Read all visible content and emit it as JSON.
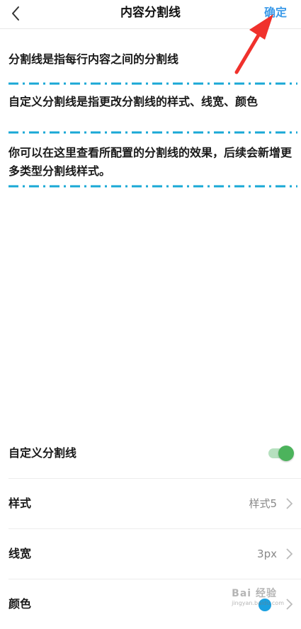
{
  "header": {
    "title": "内容分割线",
    "confirm_label": "确定"
  },
  "preview": {
    "paragraphs": [
      "分割线是指每行内容之间的分割线",
      "自定义分割线是指更改分割线的样式、线宽、颜色",
      "你可以在这里查看所配置的分割线的效果，后续会新增更多类型分割线样式。"
    ],
    "divider_color": "#1aa8d6"
  },
  "settings": {
    "custom_divider": {
      "label": "自定义分割线",
      "enabled": true,
      "toggle_color": "#4cb35c"
    },
    "style": {
      "label": "样式",
      "value": "样式5"
    },
    "width": {
      "label": "线宽",
      "value": "3px"
    },
    "color": {
      "label": "颜色",
      "swatch": "#1aa0e0"
    }
  },
  "annotation": {
    "arrow_color": "#f0312c"
  },
  "watermark": {
    "text": "Bai 经验",
    "subtext": "jingyan.baidu.com"
  }
}
